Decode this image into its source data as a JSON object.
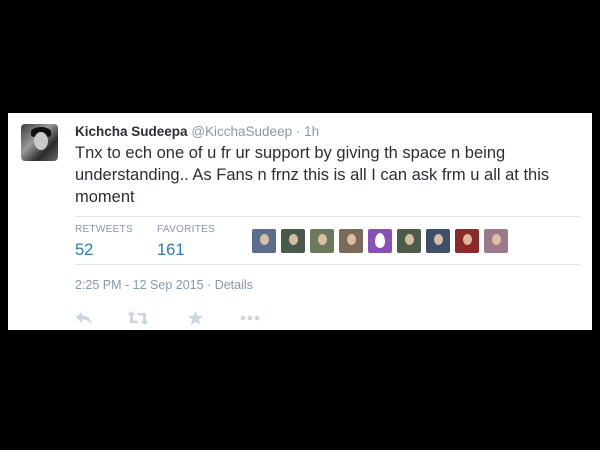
{
  "tweet": {
    "author_name": "Kichcha Sudeepa",
    "author_handle": "@KicchaSudeep",
    "separator": "·",
    "time_ago": "1h",
    "text": "Tnx to ech one of u fr ur support by giving th space n being understanding.. As Fans n frnz this is all I can ask frm u all at this moment",
    "stats": {
      "retweets_label": "RETWEETS",
      "retweets_value": "52",
      "favorites_label": "FAVORITES",
      "favorites_value": "161"
    },
    "timestamp": "2:25 PM - 12 Sep 2015",
    "details_sep": "·",
    "details_link": "Details"
  },
  "favoriter_avatars": [
    {
      "name": "favoriter-avatar-1",
      "color": "#5a6e8c"
    },
    {
      "name": "favoriter-avatar-2",
      "color": "#4a5a4a"
    },
    {
      "name": "favoriter-avatar-3",
      "color": "#6b7a5a"
    },
    {
      "name": "favoriter-avatar-4",
      "color": "#7a6a5a"
    },
    {
      "name": "favoriter-avatar-egg",
      "color": "#8b4fb8"
    },
    {
      "name": "favoriter-avatar-5",
      "color": "#4d5c4a"
    },
    {
      "name": "favoriter-avatar-6",
      "color": "#3f4f6a"
    },
    {
      "name": "favoriter-avatar-7",
      "color": "#8a2a2a"
    },
    {
      "name": "favoriter-avatar-8",
      "color": "#9a7a8a"
    }
  ],
  "icons": {
    "reply": "reply-icon",
    "retweet": "retweet-icon",
    "favorite": "star-icon",
    "more": "more-icon"
  },
  "colors": {
    "background": "#000000",
    "card": "#ffffff",
    "name": "#292f33",
    "muted": "#8899a6",
    "stat_value": "#2b7bb9",
    "icon": "#ccd6dd"
  }
}
